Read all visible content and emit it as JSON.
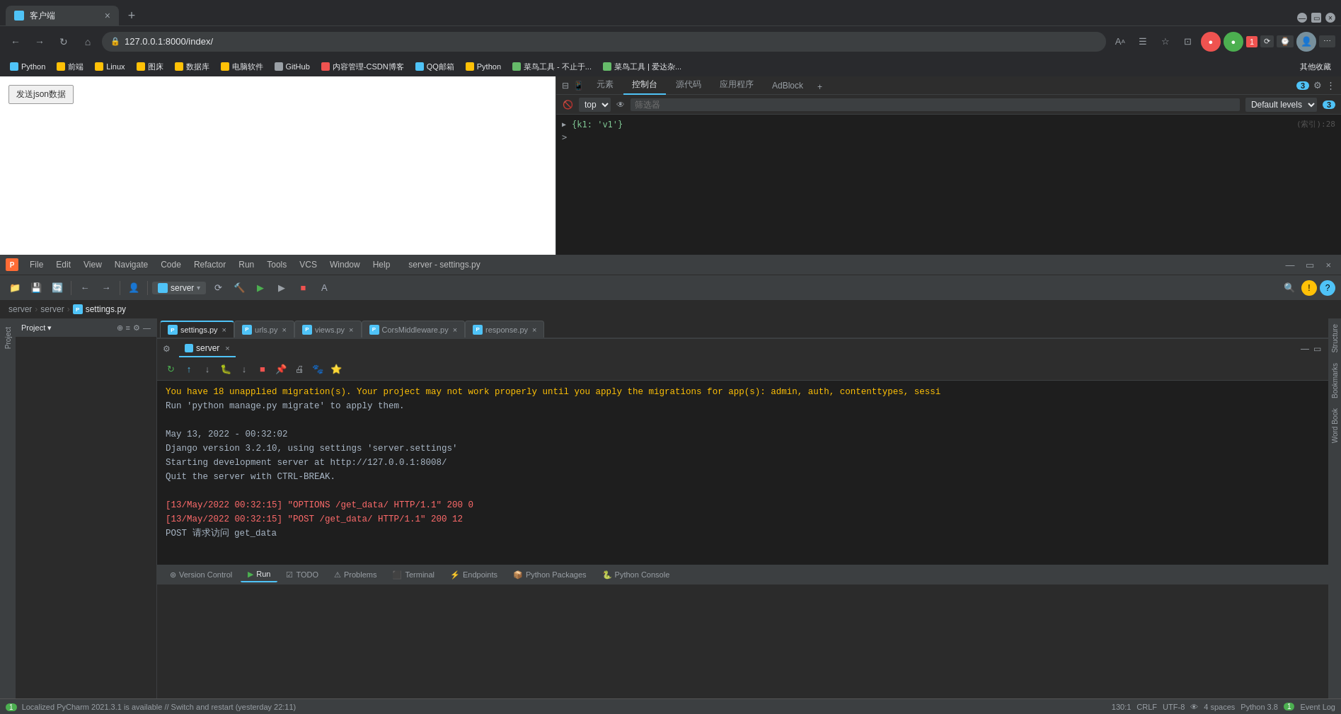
{
  "browser": {
    "tab_title": "客户端",
    "tab_close": "×",
    "new_tab_btn": "+",
    "nav_back": "←",
    "nav_forward": "→",
    "nav_reload": "↻",
    "nav_home": "⌂",
    "address": "127.0.0.1:8000/index/",
    "lock_icon": "🔒",
    "bookmarks": [
      {
        "label": "Python",
        "color": "blue"
      },
      {
        "label": "前端",
        "color": "yellow"
      },
      {
        "label": "Linux",
        "color": "yellow"
      },
      {
        "label": "图床",
        "color": "yellow"
      },
      {
        "label": "数据库",
        "color": "yellow"
      },
      {
        "label": "电脑软件",
        "color": "yellow"
      },
      {
        "label": "GitHub",
        "color": "gray"
      },
      {
        "label": "内容管理-CSDN博客",
        "color": "red"
      },
      {
        "label": "QQ邮箱",
        "color": "blue"
      },
      {
        "label": "Python",
        "color": "yellow"
      },
      {
        "label": "菜鸟工具 - 不止于...",
        "color": "green"
      },
      {
        "label": "菜鸟工具 | 爱达杂...",
        "color": "green"
      },
      {
        "label": "其他收藏",
        "color": "gray"
      }
    ],
    "send_btn_label": "发送json数据",
    "devtools": {
      "tabs": [
        "元素",
        "控制台",
        "源代码",
        "应用程序",
        "AdBlock"
      ],
      "active_tab": "控制台",
      "tab_icons_count": "3",
      "toolbar_dropdown": "top",
      "filter_placeholder": "筛选器",
      "levels_label": "Default levels",
      "badge_count": "3",
      "console_lines": [
        {
          "arrow": "▶",
          "content": "{k1: 'v1'}"
        },
        {
          "arrow": ">",
          "content": ""
        }
      ]
    }
  },
  "ide": {
    "title": "server - settings.py",
    "menu_items": [
      "File",
      "Edit",
      "View",
      "Navigate",
      "Code",
      "Refactor",
      "Run",
      "Tools",
      "VCS",
      "Window",
      "Help"
    ],
    "run_config": "server",
    "breadcrumb": {
      "parts": [
        "server",
        "server",
        "settings.py"
      ]
    },
    "file_tabs": [
      {
        "name": "settings.py",
        "active": true
      },
      {
        "name": "urls.py",
        "active": false
      },
      {
        "name": "views.py",
        "active": false
      },
      {
        "name": "CorsMiddleware.py",
        "active": false
      },
      {
        "name": "response.py",
        "active": false
      }
    ],
    "run_panel": {
      "tab_label": "server",
      "run_label": "Run",
      "console_lines": [
        {
          "text": "You have 18 unapplied migration(s). Your project may not work properly until you apply the migrations for app(s): admin, auth, contenttypes, sessi",
          "type": "warning"
        },
        {
          "text": "Run 'python manage.py migrate' to apply them.",
          "type": "info"
        },
        {
          "text": "",
          "type": "info"
        },
        {
          "text": "May 13, 2022 - 00:32:02",
          "type": "info"
        },
        {
          "text": "Django version 3.2.10, using settings 'server.settings'",
          "type": "info"
        },
        {
          "text": "Starting development server at http://127.0.0.1:8008/",
          "type": "info"
        },
        {
          "text": "Quit the server with CTRL-BREAK.",
          "type": "info"
        },
        {
          "text": "",
          "type": "info"
        },
        {
          "text": "[13/May/2022 00:32:15] \"OPTIONS /get_data/ HTTP/1.1\" 200 0",
          "type": "error"
        },
        {
          "text": "[13/May/2022 00:32:15] \"POST /get_data/ HTTP/1.1\" 200 12",
          "type": "error"
        },
        {
          "text": "POST 请求访问 get_data",
          "type": "info"
        }
      ],
      "server_link": "http://127.0.0.1:8008/"
    },
    "bottom_tabs": [
      {
        "label": "Version Control",
        "icon": ""
      },
      {
        "label": "Run",
        "icon": "▶",
        "active": true
      },
      {
        "label": "TODO",
        "icon": ""
      },
      {
        "label": "Problems",
        "icon": ""
      },
      {
        "label": "Terminal",
        "icon": ""
      },
      {
        "label": "Endpoints",
        "icon": ""
      },
      {
        "label": "Python Packages",
        "icon": ""
      },
      {
        "label": "Python Console",
        "icon": ""
      }
    ],
    "status_bar": {
      "message": "Localized PyCharm 2021.3.1 is available // Switch and restart (yesterday 22:11)",
      "position": "130:1",
      "encoding": "CRLF",
      "encoding2": "UTF-8",
      "eye_icon": "👁",
      "spaces": "4 spaces",
      "python": "Python 3.8",
      "event_log": "Event Log",
      "event_log_count": "1"
    }
  }
}
